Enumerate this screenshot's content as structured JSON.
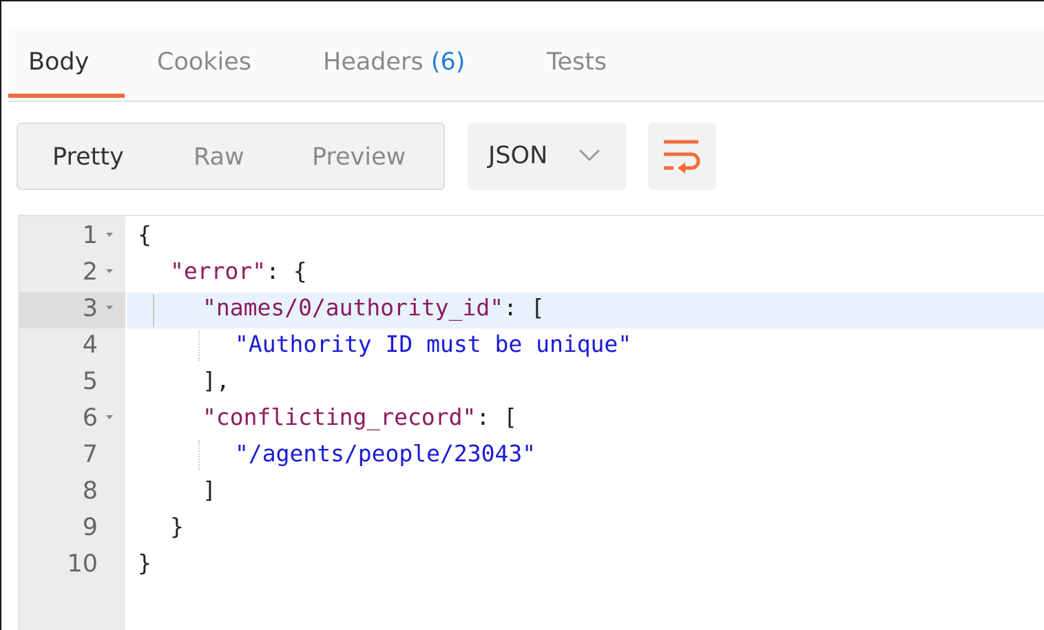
{
  "tabs": [
    {
      "label": "Body",
      "active": true
    },
    {
      "label": "Cookies",
      "active": false
    },
    {
      "label": "Headers",
      "count": "(6)",
      "active": false
    },
    {
      "label": "Tests",
      "active": false
    }
  ],
  "toolbar": {
    "view_modes": [
      {
        "label": "Pretty",
        "active": true
      },
      {
        "label": "Raw",
        "active": false
      },
      {
        "label": "Preview",
        "active": false
      }
    ],
    "format": "JSON",
    "format_icon": "chevron-down-icon",
    "wrap_icon": "wrap-lines-icon"
  },
  "colors": {
    "accent": "#f26b3a",
    "count_blue": "#1f7de1",
    "json_key": "#8b1a5f",
    "json_string": "#1a1ad6",
    "active_line": "#e8f2fd"
  },
  "editor": {
    "active_line": 3,
    "lines": [
      {
        "num": "1",
        "foldable": true,
        "open": "{",
        "key": "",
        "sep": "",
        "value": "",
        "close": ""
      },
      {
        "num": "2",
        "foldable": true,
        "open": "",
        "key": "\"error\"",
        "sep": ": ",
        "value": "",
        "close": "{"
      },
      {
        "num": "3",
        "foldable": true,
        "open": "",
        "key": "\"names/0/authority_id\"",
        "sep": ": ",
        "value": "",
        "close": "["
      },
      {
        "num": "4",
        "foldable": false,
        "open": "",
        "key": "",
        "sep": "",
        "value": "\"Authority ID must be unique\"",
        "close": ""
      },
      {
        "num": "5",
        "foldable": false,
        "open": "],",
        "key": "",
        "sep": "",
        "value": "",
        "close": ""
      },
      {
        "num": "6",
        "foldable": true,
        "open": "",
        "key": "\"conflicting_record\"",
        "sep": ": ",
        "value": "",
        "close": "["
      },
      {
        "num": "7",
        "foldable": false,
        "open": "",
        "key": "",
        "sep": "",
        "value": "\"/agents/people/23043\"",
        "close": ""
      },
      {
        "num": "8",
        "foldable": false,
        "open": "]",
        "key": "",
        "sep": "",
        "value": "",
        "close": ""
      },
      {
        "num": "9",
        "foldable": false,
        "open": "}",
        "key": "",
        "sep": "",
        "value": "",
        "close": ""
      },
      {
        "num": "10",
        "foldable": false,
        "open": "}",
        "key": "",
        "sep": "",
        "value": "",
        "close": ""
      }
    ]
  }
}
